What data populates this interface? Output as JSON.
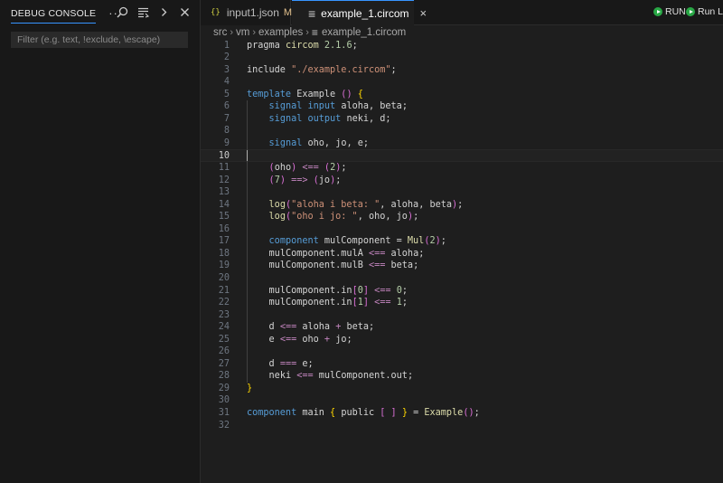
{
  "panel": {
    "title": "DEBUG CONSOLE",
    "more": "···",
    "filter_placeholder": "Filter (e.g. text, !exclude, \\escape)"
  },
  "tabs": [
    {
      "icon": "{}",
      "label": "input1.json",
      "status": "M"
    },
    {
      "label": "example_1.circom",
      "close": "×"
    }
  ],
  "run_buttons": [
    {
      "label": "RUN"
    },
    {
      "label": "Run Las"
    }
  ],
  "breadcrumb": [
    "src",
    "vm",
    "examples",
    "example_1.circom"
  ],
  "editor": {
    "active_line": 10,
    "lines": [
      "pragma circom 2.1.6;",
      "",
      "include \"./example.circom\";",
      "",
      "template Example () {",
      "    signal input aloha, beta;",
      "    signal output neki, d;",
      "",
      "    signal oho, jo, e;",
      "",
      "    (oho) <== (2);",
      "    (7) ==> (jo);",
      "",
      "    log(\"aloha i beta: \", aloha, beta);",
      "    log(\"oho i jo: \", oho, jo);",
      "",
      "    component mulComponent = Mul(2);",
      "    mulComponent.mulA <== aloha;",
      "    mulComponent.mulB <== beta;",
      "",
      "    mulComponent.in[0] <== 0;",
      "    mulComponent.in[1] <== 1;",
      "",
      "    d <== aloha + beta;",
      "    e <== oho + jo;",
      "",
      "    d === e;",
      "    neki <== mulComponent.out;",
      "}",
      "",
      "component main { public [ ] } = Example();",
      ""
    ]
  },
  "colors": {
    "accent": "#3794ff",
    "run_green": "#28a745",
    "editor_bg": "#1e1e1e",
    "panel_bg": "#181818"
  },
  "icons": [
    "search-icon",
    "filter-list-icon",
    "chevron-right-icon",
    "close-icon",
    "json-file-icon",
    "circom-file-icon",
    "play-icon"
  ]
}
